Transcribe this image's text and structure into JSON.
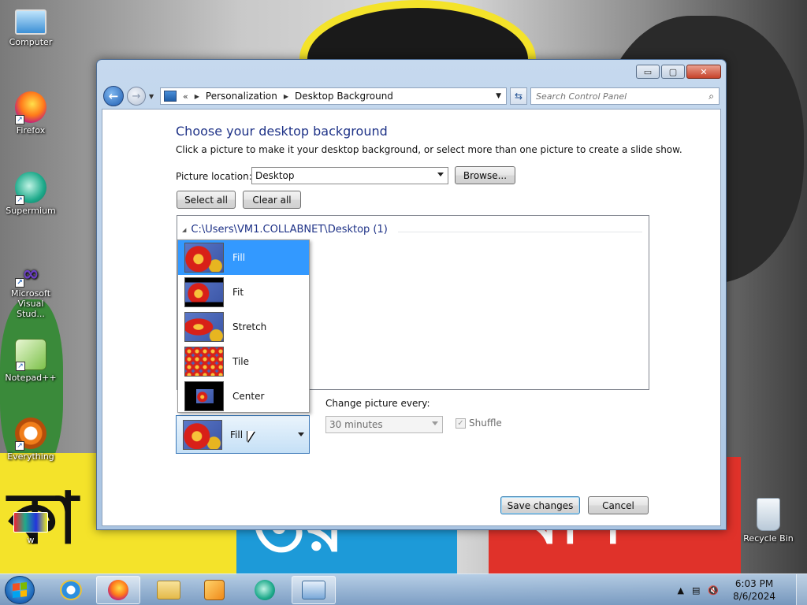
{
  "desktop": {
    "icons": [
      {
        "label": "Computer"
      },
      {
        "label": "Firefox"
      },
      {
        "label": "Supermium"
      },
      {
        "label": "Microsoft Visual Stud..."
      },
      {
        "label": "Notepad++"
      },
      {
        "label": "Everything"
      },
      {
        "label": "w"
      },
      {
        "label": "Recycle Bin"
      }
    ]
  },
  "window": {
    "caption": {
      "minimize": "▭",
      "maximize": "▢",
      "close": "✕"
    },
    "breadcrumb": {
      "root_chevron": "«",
      "items": [
        "Personalization",
        "Desktop Background"
      ]
    },
    "search": {
      "placeholder": "Search Control Panel"
    },
    "heading": "Choose your desktop background",
    "subtext": "Click a picture to make it your desktop background, or select more than one picture to create a slide show.",
    "picture_location": {
      "label": "Picture location:",
      "value": "Desktop"
    },
    "browse_label": "Browse...",
    "select_all_label": "Select all",
    "clear_all_label": "Clear all",
    "group_header": "C:\\Users\\VM1.COLLABNET\\Desktop (1)",
    "picture_position": {
      "current": "Fill",
      "options": [
        "Fill",
        "Fit",
        "Stretch",
        "Tile",
        "Center"
      ],
      "selected_index": 0
    },
    "change_picture": {
      "label": "Change picture every:",
      "value": "30 minutes",
      "disabled": true
    },
    "shuffle": {
      "label": "Shuffle",
      "checked": true,
      "disabled": true
    },
    "save_label": "Save changes",
    "cancel_label": "Cancel"
  },
  "taskbar": {
    "clock": {
      "time": "6:03 PM",
      "date": "8/6/2024"
    }
  },
  "colors": {
    "heading": "#1e3287",
    "selection": "#3399ff",
    "taskbar": "#9bb8d8"
  }
}
